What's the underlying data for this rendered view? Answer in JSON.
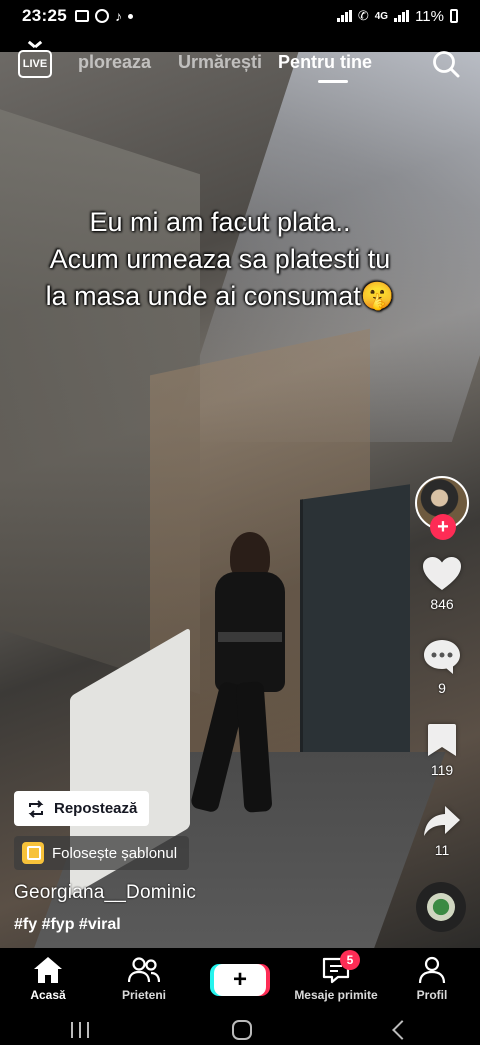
{
  "status_bar": {
    "time": "23:25",
    "network": "4G",
    "battery": "11%"
  },
  "top_nav": {
    "live_label": "LIVE",
    "tabs": [
      {
        "label": "Explorează",
        "visible_text": "ploreaza"
      },
      {
        "label": "Urmărești"
      },
      {
        "label": "Pentru tine",
        "active": true
      }
    ]
  },
  "video": {
    "caption_lines": [
      "Eu mi am facut plata..",
      "Acum urmeaza sa platesti tu",
      "la masa unde ai consumat🤫"
    ]
  },
  "rail": {
    "likes": "846",
    "comments": "9",
    "saves": "119",
    "shares": "11"
  },
  "overlay": {
    "repost_label": "Repostează",
    "template_label": "Folosește șablonul",
    "username": "Georgiana__Dominic",
    "hashtags": "#fy #fyp #viral"
  },
  "tab_bar": {
    "home": "Acasă",
    "friends": "Prieteni",
    "create": "+",
    "inbox": "Mesaje primite",
    "inbox_badge": "5",
    "profile": "Profil"
  },
  "colors": {
    "accent_red": "#fe2c55",
    "accent_cyan": "#25f4ee",
    "background": "#000000",
    "template_icon": "#f7c23a"
  }
}
